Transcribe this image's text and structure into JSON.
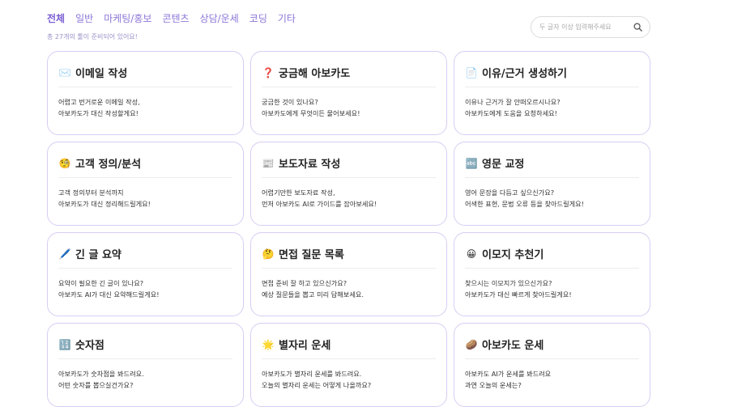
{
  "nav": {
    "tabs": [
      {
        "label": "전체",
        "active": true
      },
      {
        "label": "일반",
        "active": false
      },
      {
        "label": "마케팅/홍보",
        "active": false
      },
      {
        "label": "콘텐츠",
        "active": false
      },
      {
        "label": "상담/운세",
        "active": false
      },
      {
        "label": "코딩",
        "active": false
      },
      {
        "label": "기타",
        "active": false
      }
    ],
    "count_text": "총 27개의 툴이 준비되어 있어요!"
  },
  "search": {
    "placeholder": "두 글자 이상 입력해주세요",
    "value": "",
    "icon": "search-icon"
  },
  "colors": {
    "accent": "#7b5fd3",
    "card_border": "#d8cdf3"
  },
  "cards": [
    {
      "icon": "✉️",
      "icon_name": "envelope-icon",
      "title": "이메일 작성",
      "desc_line1": "어렵고 번거로운 이메일 작성,",
      "desc_line2": "아보카도가 대신 작성할게요!"
    },
    {
      "icon": "❓",
      "icon_name": "question-mark-icon",
      "title": "궁금해 아보카도",
      "desc_line1": "궁금한 것이 있나요?",
      "desc_line2": "아보카도에게 무엇이든 물어보세요!"
    },
    {
      "icon": "📄",
      "icon_name": "document-icon",
      "title": "이유/근거 생성하기",
      "desc_line1": "이유나 근거가 잘 안떠오르시나요?",
      "desc_line2": "아보카도에게 도움을 요청하세요!"
    },
    {
      "icon": "🧐",
      "icon_name": "monocle-face-icon",
      "title": "고객 정의/분석",
      "desc_line1": "고객 정의부터 분석까지",
      "desc_line2": "아보카도가 대신 정리해드릴게요!"
    },
    {
      "icon": "📰",
      "icon_name": "newspaper-icon",
      "title": "보도자료 작성",
      "desc_line1": "어렵기만한 보도자료 작성,",
      "desc_line2": "먼저 아보카도 AI로 가이드를 잡아보세요!"
    },
    {
      "icon": "🔤",
      "icon_name": "abc-icon",
      "title": "영문 교정",
      "desc_line1": "영어 문장을 다듬고 싶으신가요?",
      "desc_line2": "어색한 표현, 문법 오류 등을 찾아드릴게요!"
    },
    {
      "icon": "🖊️",
      "icon_name": "pen-icon",
      "title": "긴 글 요약",
      "desc_line1": "요약이 필요한 긴 글이 있나요?",
      "desc_line2": "아보카도 AI가 대신 요약해드릴게요!"
    },
    {
      "icon": "🤔",
      "icon_name": "thinking-face-icon",
      "title": "면접 질문 목록",
      "desc_line1": "면접 준비 잘 하고 있으신가요?",
      "desc_line2": "예상 질문들을 뽑고 미리 답해보세요."
    },
    {
      "icon": "😀",
      "icon_name": "smiley-icon",
      "title": "이모지 추천기",
      "desc_line1": "찾으시는 이모지가 있으신가요?",
      "desc_line2": "아보카도가 대신 빠르게 찾아드릴게요!"
    },
    {
      "icon": "🔢",
      "icon_name": "numbers-icon",
      "title": "숫자점",
      "desc_line1": "아보카도가 숫자점을 봐드려요.",
      "desc_line2": "어떤 숫자를 뽑으실건가요?"
    },
    {
      "icon": "🌟",
      "icon_name": "star-icon",
      "title": "별자리 운세",
      "desc_line1": "아보카도가 별자리 운세를 봐드려요.",
      "desc_line2": "오늘의 별자리 운세는 어떻게 나올까요?"
    },
    {
      "icon": "🥔",
      "icon_name": "avocado-icon",
      "title": "아보카도 운세",
      "desc_line1": "아보카도 AI가 운세를 봐드려요",
      "desc_line2": "과연 오늘의 운세는?"
    }
  ]
}
